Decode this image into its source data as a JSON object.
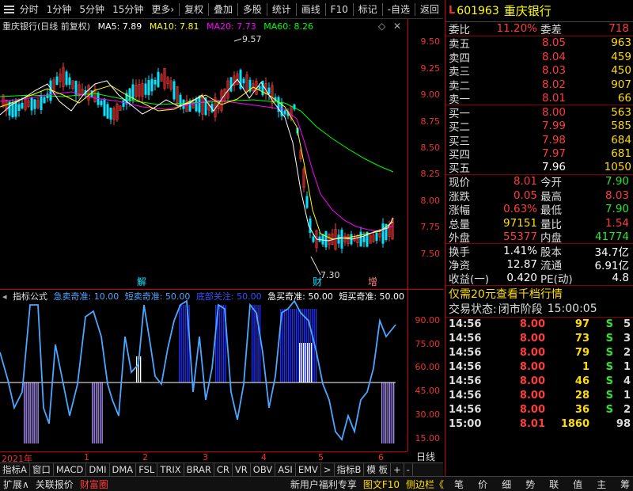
{
  "toolbar": {
    "items": [
      "分时",
      "1分钟",
      "5分钟",
      "15分钟",
      "更多›",
      "复权",
      "叠加",
      "多股",
      "统计",
      "画线",
      "F10",
      "标记",
      "-自选",
      "返回"
    ]
  },
  "chart": {
    "stock_label": "重庆银行(日线 前复权)",
    "ma5": "MA5: 7.89",
    "ma10": "MA10: 7.81",
    "ma20": "MA20: 7.73",
    "ma60": "MA60: 8.26",
    "high_label": "9.57",
    "low_label": "7.30",
    "event_jie": "解",
    "event_cai": "财",
    "event_zeng": "增",
    "y_ticks": [
      "9.50",
      "9.25",
      "9.00",
      "8.75",
      "8.50",
      "8.25",
      "8.00",
      "7.75",
      "7.50"
    ],
    "colors": {
      "ma5": "#ffffff",
      "ma10": "#ffff00",
      "ma20": "#ff00ff",
      "ma60": "#00ff00"
    }
  },
  "indicator": {
    "name": "指标公式",
    "l1": "急卖奇准: 10.00",
    "l2": "短卖奇准: 50.00",
    "l3": "底部关注: 50.00",
    "l4": "急买奇准: 50.00",
    "l5": "短买奇准: 50.00",
    "y_ticks": [
      "90.00",
      "75.00",
      "60.00",
      "45.00",
      "30.00",
      "15.00"
    ]
  },
  "xaxis": {
    "labels": [
      "2021年",
      "1",
      "2",
      "3",
      "4",
      "5",
      "6"
    ],
    "period": "日线"
  },
  "tabs": [
    "指标A",
    "窗口",
    "MACD",
    "DMI",
    "DMA",
    "FSL",
    "TRIX",
    "BRAR",
    "CR",
    "VR",
    "OBV",
    "ASI",
    "EMV",
    ">",
    "指标B",
    "模 板",
    "+",
    "-"
  ],
  "bottom": {
    "left": [
      "扩展∧",
      "关联报价",
      "财富圈"
    ],
    "mid": [
      "新用户福利专享",
      "图文F10",
      "侧边栏《"
    ],
    "right": [
      "笔",
      "价",
      "细",
      "势",
      "联",
      "值",
      "主",
      "筹"
    ]
  },
  "quote": {
    "badge": "L",
    "code": "601963",
    "name": "重庆银行",
    "weibi_label": "委比",
    "weibi": "11.20%",
    "weicha_label": "委差",
    "weicha": "718",
    "sells": [
      {
        "label": "卖五",
        "price": "8.05",
        "vol": "963"
      },
      {
        "label": "卖四",
        "price": "8.04",
        "vol": "459"
      },
      {
        "label": "卖三",
        "price": "8.03",
        "vol": "450"
      },
      {
        "label": "卖二",
        "price": "8.02",
        "vol": "907"
      },
      {
        "label": "卖一",
        "price": "8.01",
        "vol": "66"
      }
    ],
    "buys": [
      {
        "label": "买一",
        "price": "8.00",
        "vol": "563"
      },
      {
        "label": "买二",
        "price": "7.99",
        "vol": "585"
      },
      {
        "label": "买三",
        "price": "7.98",
        "vol": "684"
      },
      {
        "label": "买四",
        "price": "7.97",
        "vol": "681"
      },
      {
        "label": "买五",
        "price": "7.96",
        "vol": "1050"
      }
    ],
    "stats": [
      {
        "l1": "现价",
        "v1": "8.01",
        "l2": "今开",
        "v2": "7.90"
      },
      {
        "l1": "涨跌",
        "v1": "0.05",
        "l2": "最高",
        "v2": "8.03"
      },
      {
        "l1": "涨幅",
        "v1": "0.63%",
        "l2": "最低",
        "v2": "7.90"
      },
      {
        "l1": "总量",
        "v1": "97151",
        "l2": "量比",
        "v2": "1.54"
      },
      {
        "l1": "外盘",
        "v1": "55377",
        "l2": "内盘",
        "v2": "41774"
      }
    ],
    "stats2": [
      {
        "l1": "换手",
        "v1": "1.41%",
        "l2": "股本",
        "v2": "34.7亿"
      },
      {
        "l1": "净资",
        "v1": "12.87",
        "l2": "流通",
        "v2": "6.91亿"
      },
      {
        "l1": "收益(一)",
        "v1": "0.420",
        "l2": "PE(动)",
        "v2": "4.8"
      }
    ],
    "promo": "仅需20元查看千档行情",
    "status_label": "交易状态:",
    "status_value": "闭市阶段",
    "status_time": "15:00:05",
    "ticks": [
      {
        "t": "14:56",
        "p": "8.00",
        "v": "97",
        "s": "S",
        "n": "5"
      },
      {
        "t": "14:56",
        "p": "8.00",
        "v": "73",
        "s": "S",
        "n": "3"
      },
      {
        "t": "14:56",
        "p": "8.00",
        "v": "79",
        "s": "S",
        "n": "2"
      },
      {
        "t": "14:56",
        "p": "8.00",
        "v": "1",
        "s": "S",
        "n": "1"
      },
      {
        "t": "14:56",
        "p": "8.00",
        "v": "46",
        "s": "S",
        "n": "4"
      },
      {
        "t": "14:56",
        "p": "8.00",
        "v": "28",
        "s": "S",
        "n": "1"
      },
      {
        "t": "14:56",
        "p": "8.00",
        "v": "36",
        "s": "S",
        "n": "2"
      },
      {
        "t": "15:00",
        "p": "8.01",
        "v": "1860",
        "s": "",
        "n": "98"
      }
    ]
  }
}
